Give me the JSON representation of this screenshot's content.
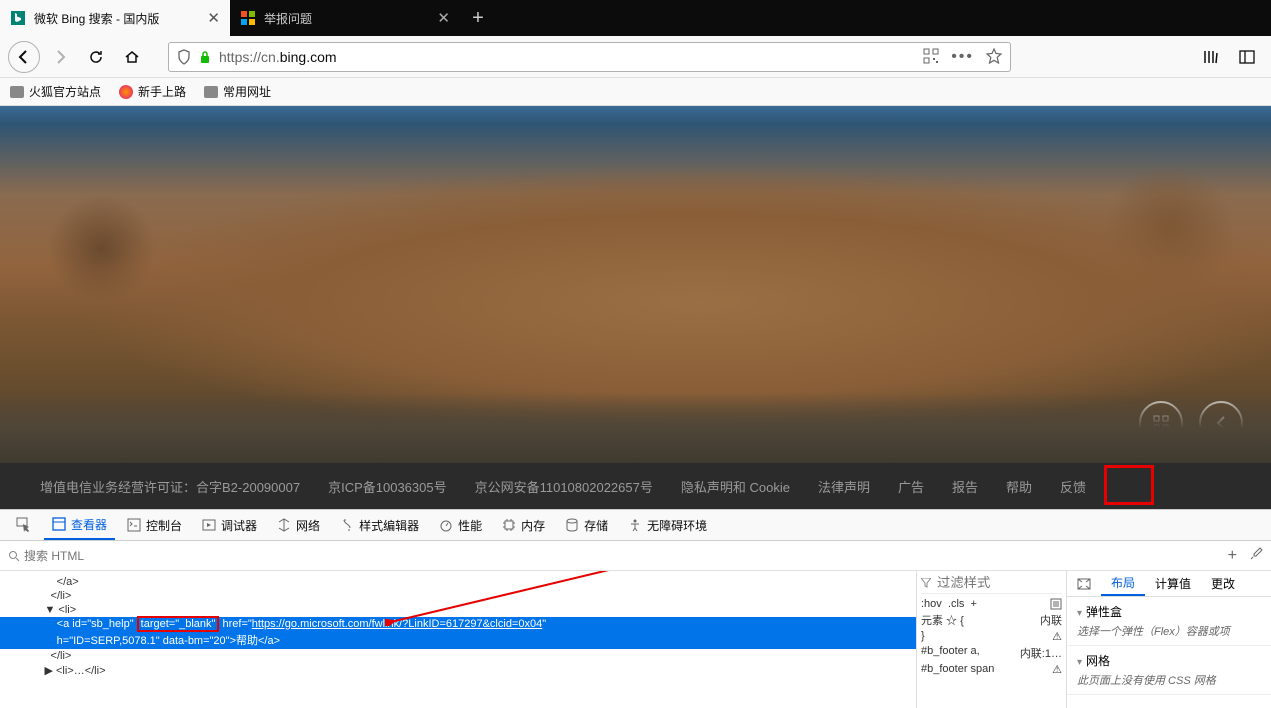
{
  "tabs": [
    {
      "title": "微软 Bing 搜索 - 国内版",
      "favicon": "bing"
    },
    {
      "title": "举报问题",
      "favicon": "ms"
    }
  ],
  "url": {
    "prefix": "https://",
    "host": "cn.",
    "domain": "bing.com"
  },
  "bookmarks": [
    {
      "label": "火狐官方站点",
      "icon": "folder"
    },
    {
      "label": "新手上路",
      "icon": "fox"
    },
    {
      "label": "常用网址",
      "icon": "folder"
    }
  ],
  "footer": {
    "license": "增值电信业务经营许可证：合字B2-20090007",
    "icp": "京ICP备10036305号",
    "gongan": "京公网安备11010802022657号",
    "privacy": "隐私声明和 Cookie",
    "legal": "法律声明",
    "ads": "广告",
    "report": "报告",
    "help": "帮助",
    "feedback": "反馈"
  },
  "devtools": {
    "tabs": [
      "查看器",
      "控制台",
      "调试器",
      "网络",
      "样式编辑器",
      "性能",
      "内存",
      "存储",
      "无障碍环境"
    ],
    "search_placeholder": "搜索 HTML",
    "filter_placeholder": "过滤样式",
    "layout_tabs": [
      "布局",
      "计算值",
      "更改"
    ],
    "dom": {
      "l1": "            </a>",
      "l2": "          </li>",
      "l3": "        ▼ <li>",
      "sel_pre": "            <a id=\"sb_help\" ",
      "sel_boxed": "target=\"_blank\"",
      "sel_mid": " href=\"",
      "sel_url": "https://go.microsoft.com/fwlink/?LinkID=617297&clcid=0x04",
      "sel_post": "\"",
      "sel_line2": "            h=\"ID=SERP,5078.1\" data-bm=\"20\">帮助</a>",
      "l6": "          </li>",
      "l7": "        ▶ <li>…</li>"
    },
    "rules": {
      "hov": ":hov",
      "cls": ".cls",
      "r1": {
        "sel": "元素 ☆ {",
        "src": "内联",
        "close": "}"
      },
      "r2": {
        "sel": "#b_footer a,",
        "src": "内联:1…"
      },
      "r3": {
        "sel": "#b_footer span",
        "src": ""
      }
    },
    "layout": {
      "flex_title": "弹性盒",
      "flex_desc": "选择一个弹性（Flex）容器或项",
      "grid_title": "网格",
      "grid_desc": "此页面上没有使用 CSS 网格"
    }
  }
}
